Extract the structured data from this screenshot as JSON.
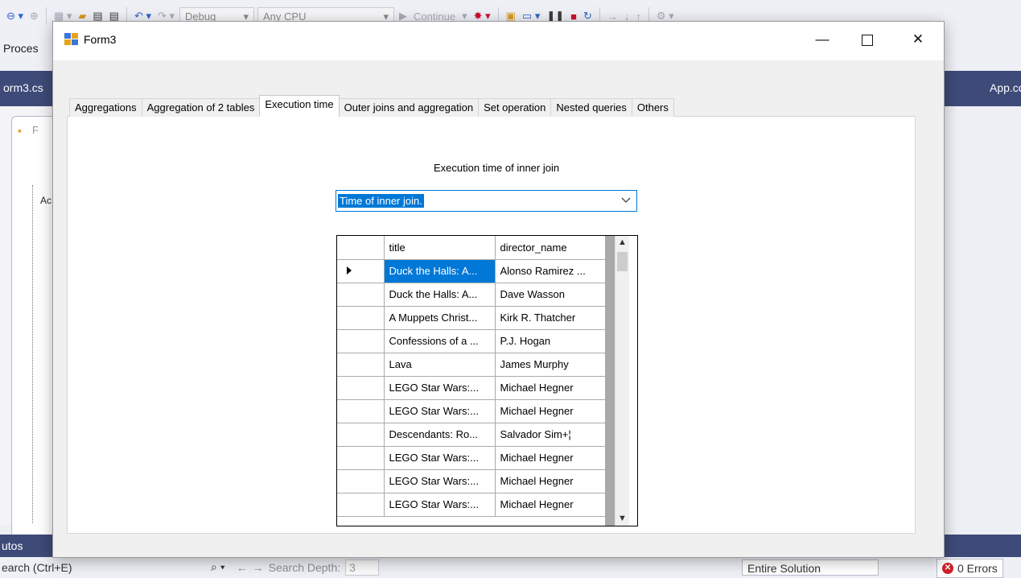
{
  "vs": {
    "config_combo": "Debug",
    "platform_combo": "Any CPU",
    "continue_label": "Continue",
    "process_label": "Proces",
    "doc_tab": "orm3.cs",
    "app_tab": "App.co",
    "designer_mini_title": "F",
    "designer_partial_label": "Ac",
    "autos_label": "utos",
    "search_label": "earch (Ctrl+E)",
    "search_depth_label": "Search Depth:",
    "search_depth_value": "3",
    "scope_combo": "Entire Solution",
    "errors_label": "0 Errors"
  },
  "form": {
    "title": "Form3",
    "tabs": [
      {
        "label": "Aggregations"
      },
      {
        "label": "Aggregation of 2 tables"
      },
      {
        "label": "Execution time"
      },
      {
        "label": "Outer joins and aggregation"
      },
      {
        "label": "Set operation"
      },
      {
        "label": "Nested queries"
      },
      {
        "label": "Others"
      }
    ],
    "active_tab": "Execution time",
    "exec_label": "Execution time of inner join",
    "combo_value": "Time of inner join.",
    "grid": {
      "columns": [
        "title",
        "director_name"
      ],
      "rows": [
        {
          "title": "Duck the Halls: A...",
          "director": "Alonso Ramirez ..."
        },
        {
          "title": "Duck the Halls: A...",
          "director": " Dave Wasson"
        },
        {
          "title": "A Muppets Christ...",
          "director": "Kirk R. Thatcher"
        },
        {
          "title": "Confessions of a ...",
          "director": "P.J. Hogan"
        },
        {
          "title": "Lava",
          "director": "James Murphy"
        },
        {
          "title": "LEGO Star Wars:...",
          "director": "Michael Hegner"
        },
        {
          "title": "LEGO Star Wars:...",
          "director": "Michael Hegner"
        },
        {
          "title": "Descendants: Ro...",
          "director": "Salvador Sim+¦"
        },
        {
          "title": "LEGO Star Wars:...",
          "director": "Michael Hegner"
        },
        {
          "title": "LEGO Star Wars:...",
          "director": "Michael Hegner"
        },
        {
          "title": "LEGO Star Wars:...",
          "director": "Michael Hegner"
        }
      ]
    }
  }
}
